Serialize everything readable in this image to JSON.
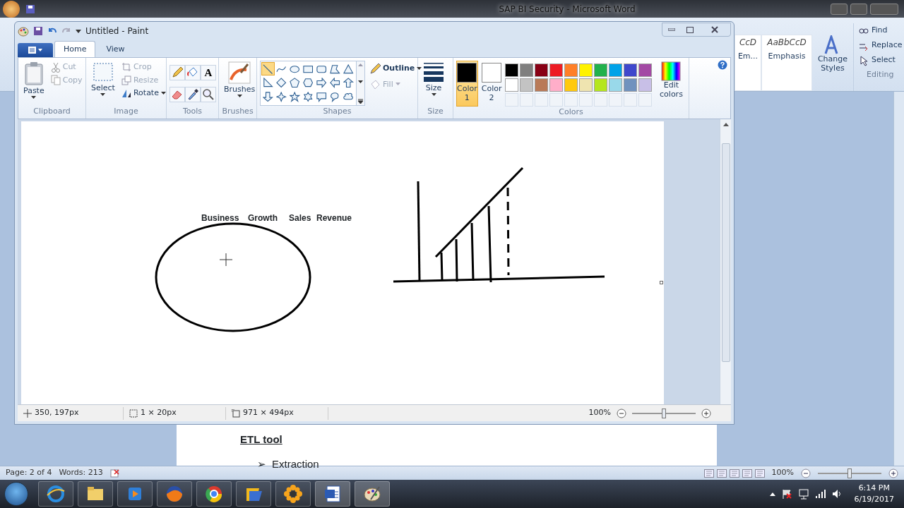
{
  "word": {
    "title": "SAP BI Security - Microsoft Word",
    "styles": [
      {
        "sample": "CcD",
        "name": "Em..."
      },
      {
        "sample": "AaBbCcD",
        "name": "Emphasis"
      }
    ],
    "change_styles": "Change Styles",
    "editing": {
      "label": "Editing",
      "items": [
        {
          "label": "Find"
        },
        {
          "label": "Replace"
        },
        {
          "label": "Select"
        }
      ]
    },
    "document": {
      "heading": "ETL tool",
      "bullets": [
        {
          "marker": "➢",
          "text": "Extraction"
        }
      ]
    },
    "status": {
      "page": "Page: 2 of 4",
      "words": "Words: 213",
      "zoom": "100%"
    },
    "zoom_slider": {
      "level": 0.5
    }
  },
  "paint": {
    "title": "Untitled - Paint",
    "tabs": [
      {
        "label": "Home",
        "selected": true
      },
      {
        "label": "View",
        "selected": false
      }
    ],
    "clipboard": {
      "label": "Clipboard",
      "paste": "Paste",
      "items": [
        {
          "label": "Cut",
          "disabled": true
        },
        {
          "label": "Copy",
          "disabled": true
        }
      ]
    },
    "image": {
      "label": "Image",
      "select": "Select",
      "items": [
        {
          "label": "Crop",
          "disabled": true
        },
        {
          "label": "Resize",
          "disabled": true
        },
        {
          "label": "Rotate",
          "disabled": false
        }
      ]
    },
    "tools": {
      "label": "Tools",
      "text_tool": "A"
    },
    "brushes": {
      "label": "Brushes",
      "button": "Brushes"
    },
    "shapes": {
      "label": "Shapes",
      "outline": {
        "label": "Outline",
        "disabled": false
      },
      "fill": {
        "label": "Fill",
        "disabled": true
      },
      "items": [
        {
          "selected": true
        },
        {
          "selected": false
        },
        {
          "selected": false
        },
        {
          "selected": false
        },
        {
          "selected": false
        },
        {
          "selected": false
        },
        {
          "selected": false
        },
        {
          "selected": false
        },
        {
          "selected": false
        },
        {
          "selected": false
        },
        {
          "selected": false
        },
        {
          "selected": false
        },
        {
          "selected": false
        },
        {
          "selected": false
        },
        {
          "selected": false
        },
        {
          "selected": false
        },
        {
          "selected": false
        },
        {
          "selected": false
        },
        {
          "selected": false
        },
        {
          "selected": false
        },
        {
          "selected": false
        }
      ]
    },
    "size": {
      "label": "Size",
      "button": "Size"
    },
    "colors": {
      "label": "Colors",
      "edit": "Edit colors",
      "slots": [
        {
          "label": "Color 1",
          "color": "#000000",
          "selected": true
        },
        {
          "label": "Color 2",
          "color": "#ffffff",
          "selected": false
        }
      ],
      "palette": [
        {
          "kind": "swatch",
          "color": "#000000"
        },
        {
          "kind": "swatch",
          "color": "#7f7f7f"
        },
        {
          "kind": "swatch",
          "color": "#880015"
        },
        {
          "kind": "swatch",
          "color": "#ed1c24"
        },
        {
          "kind": "swatch",
          "color": "#ff7f27"
        },
        {
          "kind": "swatch",
          "color": "#fff200"
        },
        {
          "kind": "swatch",
          "color": "#22b14c"
        },
        {
          "kind": "swatch",
          "color": "#00a2e8"
        },
        {
          "kind": "swatch",
          "color": "#3f48cc"
        },
        {
          "kind": "swatch",
          "color": "#a349a4"
        },
        {
          "kind": "swatch",
          "color": "#ffffff"
        },
        {
          "kind": "swatch",
          "color": "#c3c3c3"
        },
        {
          "kind": "swatch",
          "color": "#b97a57"
        },
        {
          "kind": "swatch",
          "color": "#ffaec9"
        },
        {
          "kind": "swatch",
          "color": "#ffc90e"
        },
        {
          "kind": "swatch",
          "color": "#efe4b0"
        },
        {
          "kind": "swatch",
          "color": "#b5e61d"
        },
        {
          "kind": "swatch",
          "color": "#99d9ea"
        },
        {
          "kind": "swatch",
          "color": "#7092be"
        },
        {
          "kind": "swatch",
          "color": "#c8bfe7"
        },
        {
          "kind": "empty"
        },
        {
          "kind": "empty"
        },
        {
          "kind": "empty"
        },
        {
          "kind": "empty"
        },
        {
          "kind": "empty"
        },
        {
          "kind": "empty"
        },
        {
          "kind": "empty"
        },
        {
          "kind": "empty"
        },
        {
          "kind": "empty"
        },
        {
          "kind": "empty"
        }
      ]
    },
    "canvas": {
      "labels": [
        "Business",
        "Growth",
        "Sales",
        "Revenue"
      ]
    },
    "status": {
      "cursor": "350, 197px",
      "selection": "1 × 20px",
      "size": "971 × 494px",
      "zoom": "100%"
    },
    "zoom_slider": {
      "level": 0.5
    }
  },
  "taskbar": {
    "time": "6:14 PM",
    "date": "6/19/2017"
  }
}
